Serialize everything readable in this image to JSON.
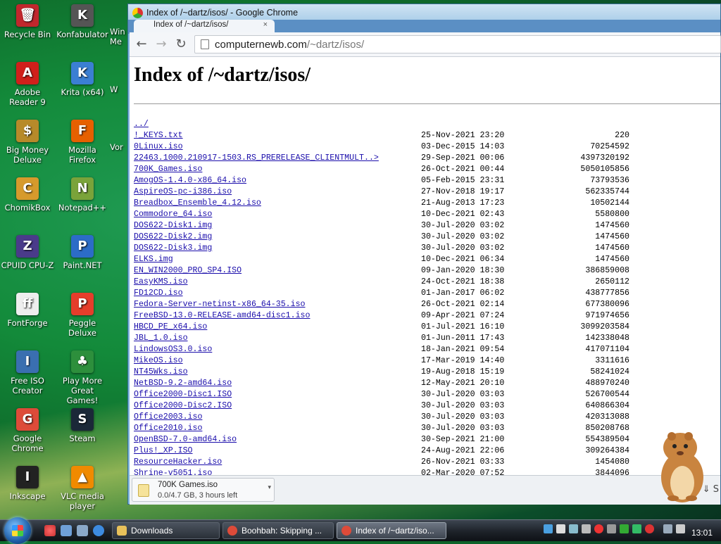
{
  "desktop": {
    "icons": [
      {
        "label": "Recycle Bin",
        "icon": "recycle-bin-icon",
        "color": "#c1272d",
        "glyph": "🗑"
      },
      {
        "label": "Konfabulator",
        "icon": "konfabulator-icon",
        "color": "#555555",
        "glyph": "K"
      },
      {
        "label": "Adobe Reader 9",
        "icon": "adobe-reader-icon",
        "color": "#d0201b",
        "glyph": "A"
      },
      {
        "label": "Krita (x64)",
        "icon": "krita-icon",
        "color": "#3b7fd3",
        "glyph": "K"
      },
      {
        "label": "Big Money Deluxe",
        "icon": "big-money-icon",
        "color": "#b78a2a",
        "glyph": "$"
      },
      {
        "label": "Mozilla Firefox",
        "icon": "firefox-icon",
        "color": "#e66000",
        "glyph": "F"
      },
      {
        "label": "ChomikBox",
        "icon": "chomikbox-icon",
        "color": "#d69a2c",
        "glyph": "C"
      },
      {
        "label": "Notepad++",
        "icon": "notepad-plus-plus-icon",
        "color": "#7aa33a",
        "glyph": "N"
      },
      {
        "label": "CPUID CPU-Z",
        "icon": "cpu-z-icon",
        "color": "#4a3b8a",
        "glyph": "Z"
      },
      {
        "label": "Paint.NET",
        "icon": "paint-net-icon",
        "color": "#2c6cc7",
        "glyph": "P"
      },
      {
        "label": "FontForge",
        "icon": "fontforge-icon",
        "color": "#eeeeee",
        "glyph": "ff"
      },
      {
        "label": "Peggle Deluxe",
        "icon": "peggle-icon",
        "color": "#e53d2b",
        "glyph": "P"
      },
      {
        "label": "Free ISO Creator",
        "icon": "free-iso-creator-icon",
        "color": "#3a6fb0",
        "glyph": "I"
      },
      {
        "label": "Play More Great Games!",
        "icon": "play-more-games-icon",
        "color": "#2d8f3c",
        "glyph": "♣"
      },
      {
        "label": "Google Chrome",
        "icon": "google-chrome-icon",
        "color": "#dd4b39",
        "glyph": "G"
      },
      {
        "label": "Steam",
        "icon": "steam-icon",
        "color": "#1b2838",
        "glyph": "S"
      },
      {
        "label": "Inkscape",
        "icon": "inkscape-icon",
        "color": "#222222",
        "glyph": "I"
      },
      {
        "label": "VLC media player",
        "icon": "vlc-icon",
        "color": "#f08a00",
        "glyph": "▲"
      }
    ],
    "partial_labels": [
      "Win Me",
      "W",
      "Vor"
    ]
  },
  "window": {
    "title": "Index of /~dartz/isos/ - Google Chrome",
    "tab_title": "Index of /~dartz/isos/",
    "tab_close": "×",
    "url_domain": "computernewb.com",
    "url_path": "/~dartz/isos/"
  },
  "page": {
    "heading": "Index of /~dartz/isos/",
    "parent_link": "../",
    "files": [
      {
        "name": "!_KEYS.txt",
        "date": "25-Nov-2021 23:20",
        "size": "220"
      },
      {
        "name": "0Linux.iso",
        "date": "03-Dec-2015 14:03",
        "size": "70254592"
      },
      {
        "name": "22463.1000.210917-1503.RS_PRERELEASE_CLIENTMULT..>",
        "date": "29-Sep-2021 00:06",
        "size": "4397320192"
      },
      {
        "name": "700K_Games.iso",
        "date": "26-Oct-2021 00:44",
        "size": "5050105856"
      },
      {
        "name": "AmogOS-1.4.0-x86_64.iso",
        "date": "05-Feb-2015 23:31",
        "size": "73793536"
      },
      {
        "name": "AspireOS-pc-i386.iso",
        "date": "27-Nov-2018 19:17",
        "size": "562335744"
      },
      {
        "name": "Breadbox_Ensemble_4.12.iso",
        "date": "21-Aug-2013 17:23",
        "size": "10502144"
      },
      {
        "name": "Commodore_64.iso",
        "date": "10-Dec-2021 02:43",
        "size": "5580800"
      },
      {
        "name": "DOS622-Disk1.img",
        "date": "30-Jul-2020 03:02",
        "size": "1474560"
      },
      {
        "name": "DOS622-Disk2.img",
        "date": "30-Jul-2020 03:02",
        "size": "1474560"
      },
      {
        "name": "DOS622-Disk3.img",
        "date": "30-Jul-2020 03:02",
        "size": "1474560"
      },
      {
        "name": "ELKS.img",
        "date": "10-Dec-2021 06:34",
        "size": "1474560"
      },
      {
        "name": "EN_WIN2000_PRO_SP4.ISO",
        "date": "09-Jan-2020 18:30",
        "size": "386859008"
      },
      {
        "name": "EasyKMS.iso",
        "date": "24-Oct-2021 18:38",
        "size": "2650112"
      },
      {
        "name": "FD12CD.iso",
        "date": "01-Jan-2017 06:02",
        "size": "438777856"
      },
      {
        "name": "Fedora-Server-netinst-x86_64-35.iso",
        "date": "26-Oct-2021 02:14",
        "size": "677380096"
      },
      {
        "name": "FreeBSD-13.0-RELEASE-amd64-disc1.iso",
        "date": "09-Apr-2021 07:24",
        "size": "971974656"
      },
      {
        "name": "HBCD_PE_x64.iso",
        "date": "01-Jul-2021 16:10",
        "size": "3099203584"
      },
      {
        "name": "JBL_1.0.iso",
        "date": "01-Jun-2011 17:43",
        "size": "142338048"
      },
      {
        "name": "LindowsOS3.0.iso",
        "date": "18-Jan-2021 09:54",
        "size": "417071104"
      },
      {
        "name": "MikeOS.iso",
        "date": "17-Mar-2019 14:40",
        "size": "3311616"
      },
      {
        "name": "NT45Wks.iso",
        "date": "19-Aug-2018 15:19",
        "size": "58241024"
      },
      {
        "name": "NetBSD-9.2-amd64.iso",
        "date": "12-May-2021 20:10",
        "size": "488970240"
      },
      {
        "name": "Office2000-Disc1.ISO",
        "date": "30-Jul-2020 03:03",
        "size": "526700544"
      },
      {
        "name": "Office2000-Disc2.ISO",
        "date": "30-Jul-2020 03:03",
        "size": "640866304"
      },
      {
        "name": "Office2003.iso",
        "date": "30-Jul-2020 03:03",
        "size": "420313088"
      },
      {
        "name": "Office2010.iso",
        "date": "30-Jul-2020 03:03",
        "size": "850208768"
      },
      {
        "name": "OpenBSD-7.0-amd64.iso",
        "date": "30-Sep-2021 21:00",
        "size": "554389504"
      },
      {
        "name": "Plus!_XP.ISO",
        "date": "24-Aug-2021 22:06",
        "size": "309264384"
      },
      {
        "name": "ResourceHacker.iso",
        "date": "26-Nov-2021 03:33",
        "size": "1454080"
      },
      {
        "name": "Shrine-v5051.iso",
        "date": "02-Mar-2020 07:52",
        "size": "3844096"
      }
    ]
  },
  "downloads": {
    "item_name": "700K Games.iso",
    "item_status": "0.0/4.7 GB, 3 hours left",
    "caret": "▾",
    "show_all": "S"
  },
  "taskbar": {
    "buttons": [
      {
        "label": "Downloads",
        "icon": "folder-icon",
        "color": "#e8c15a",
        "active": false
      },
      {
        "label": "Boohbah: Skipping ...",
        "icon": "chrome-icon",
        "color": "#dd4b39",
        "active": false
      },
      {
        "label": "Index of /~dartz/iso...",
        "icon": "chrome-icon",
        "color": "#dd4b39",
        "active": true
      }
    ],
    "clock": "13:01",
    "accent": "#1f5fa8"
  }
}
